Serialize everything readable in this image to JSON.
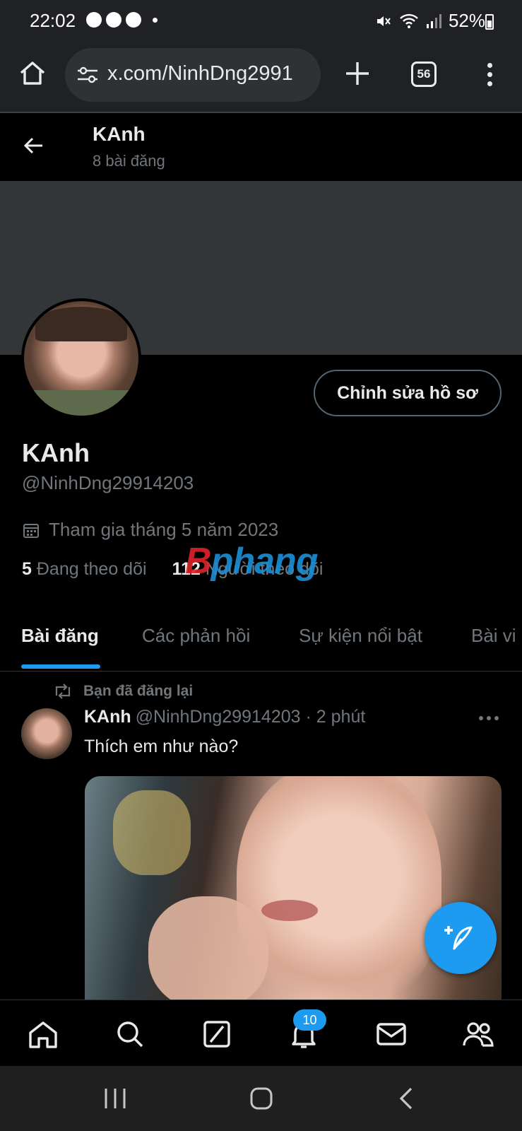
{
  "status_bar": {
    "time": "22:02",
    "battery": "52%"
  },
  "browser": {
    "url": "x.com/NinhDng2991",
    "tab_count": "56"
  },
  "header": {
    "name": "KAnh",
    "post_count": "8 bài đăng"
  },
  "profile": {
    "name": "KAnh",
    "handle": "@NinhDng29914203",
    "joined": "Tham gia tháng 5 năm 2023",
    "following_count": "5",
    "following_label": "Đang theo dõi",
    "followers_count": "112",
    "followers_label": "Người theo dõi",
    "edit_button": "Chỉnh sửa hồ sơ"
  },
  "watermark": {
    "part1": "B",
    "part2": "phang"
  },
  "tabs": [
    {
      "label": "Bài đăng",
      "active": true
    },
    {
      "label": "Các phản hồi",
      "active": false
    },
    {
      "label": "Sự kiện nổi bật",
      "active": false
    },
    {
      "label": "Bài vi",
      "active": false
    }
  ],
  "tweet": {
    "repost_label": "Bạn đã đăng lại",
    "author": "KAnh",
    "handle": "@NinhDng29914203",
    "separator": "·",
    "time": "2 phút",
    "text": "Thích em như nào?"
  },
  "bottom_nav": {
    "items": [
      "home-icon",
      "search-icon",
      "grok-icon",
      "notifications-icon",
      "messages-icon",
      "communities-icon"
    ],
    "notification_badge": "10"
  },
  "colors": {
    "accent": "#1d9bf0",
    "background": "#000000",
    "secondary_text": "#71767b",
    "banner": "#333639"
  }
}
